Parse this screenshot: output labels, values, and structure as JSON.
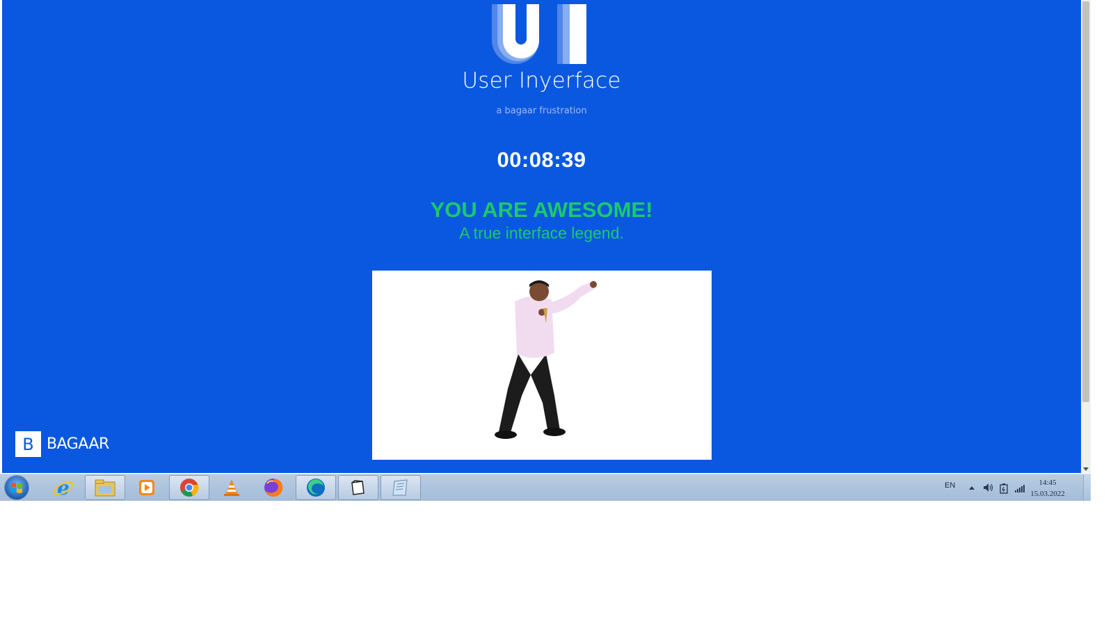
{
  "page": {
    "logo_letters": "UI",
    "app_title": "User Inyerface",
    "app_subtitle": "a bagaar frustration",
    "timer": "00:08:39",
    "headline": "YOU ARE AWESOME!",
    "subline": "A true interface legend.",
    "brand_letter": "B",
    "brand_name": "BAGAAR"
  },
  "taskbar": {
    "pinned_apps": [
      "Internet Explorer",
      "File Explorer",
      "Media Player",
      "Google Chrome",
      "VLC media player",
      "Firefox",
      "Microsoft Edge",
      "Files",
      "Notepad"
    ],
    "active_apps": [
      "File Explorer",
      "Google Chrome",
      "Microsoft Edge",
      "Files",
      "Notepad"
    ],
    "language": "EN",
    "time": "14:45",
    "date": "15.03.2022"
  },
  "colors": {
    "page_background": "#0a58e0",
    "success_green": "#1cc96b",
    "subtitle": "#9fbaf3"
  }
}
